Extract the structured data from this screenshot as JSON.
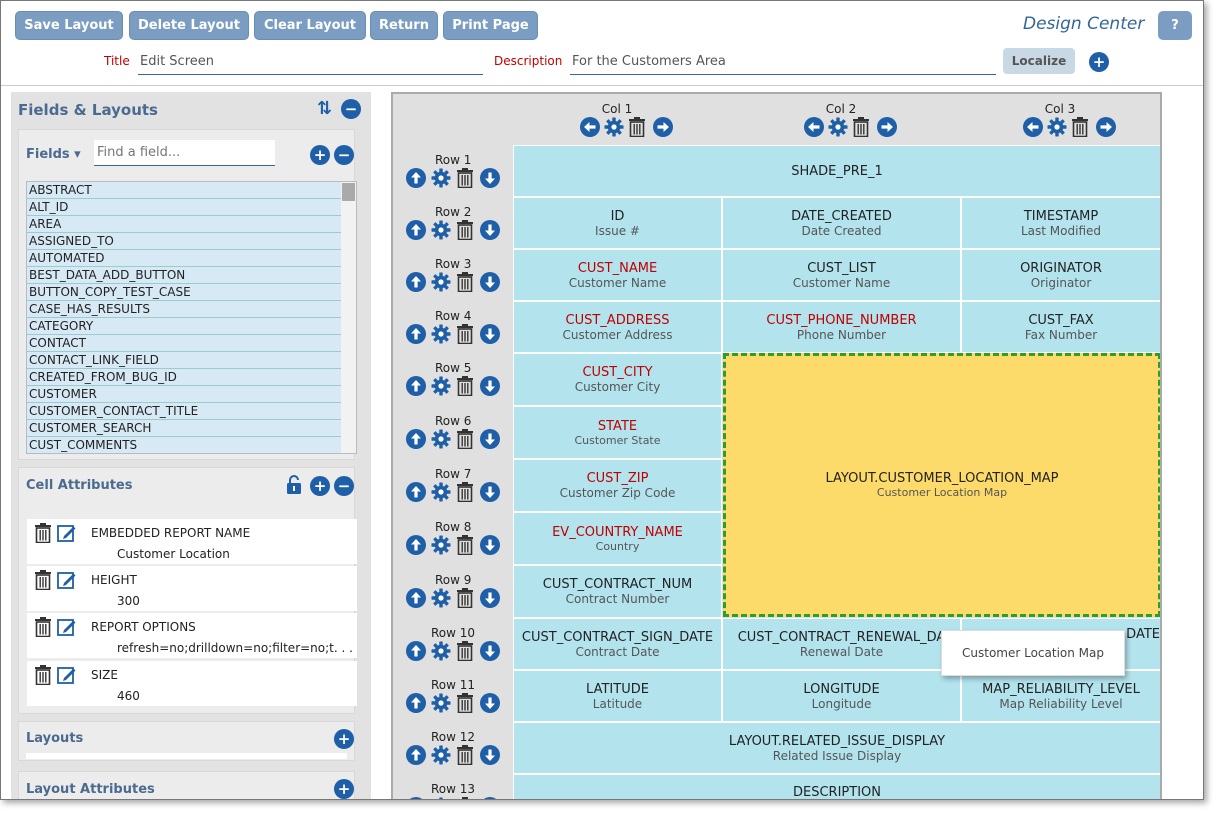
{
  "toolbar": {
    "buttons": [
      "Save Layout",
      "Delete Layout",
      "Clear Layout",
      "Return",
      "Print Page"
    ],
    "app_title": "Design Center",
    "help": "?"
  },
  "header": {
    "title_label": "Title",
    "title_value": "Edit Screen",
    "description_label": "Description",
    "description_value": "For the Customers Area",
    "localize": "Localize"
  },
  "left": {
    "title": "Fields & Layouts",
    "fields_label": "Fields ▾",
    "search_placeholder": "Find a field...",
    "fields": [
      "ABSTRACT",
      "ALT_ID",
      "AREA",
      "ASSIGNED_TO",
      "AUTOMATED",
      "BEST_DATA_ADD_BUTTON",
      "BUTTON_COPY_TEST_CASE",
      "CASE_HAS_RESULTS",
      "CATEGORY",
      "CONTACT",
      "CONTACT_LINK_FIELD",
      "CREATED_FROM_BUG_ID",
      "CUSTOMER",
      "CUSTOMER_CONTACT_TITLE",
      "CUSTOMER_SEARCH",
      "CUST_COMMENTS"
    ],
    "cell_attributes_title": "Cell Attributes",
    "attributes": [
      {
        "name": "EMBEDDED REPORT NAME",
        "value": "Customer Location"
      },
      {
        "name": "HEIGHT",
        "value": "300"
      },
      {
        "name": "REPORT OPTIONS",
        "value": "refresh=no;drilldown=no;filter=no;t. . ."
      },
      {
        "name": "SIZE",
        "value": "460"
      }
    ],
    "layouts_title": "Layouts",
    "layout_attributes_title": "Layout Attributes"
  },
  "grid": {
    "cols": [
      "Col 1",
      "Col 2",
      "Col 3"
    ],
    "rows": [
      "Row 1",
      "Row 2",
      "Row 3",
      "Row 4",
      "Row 5",
      "Row 6",
      "Row 7",
      "Row 8",
      "Row 9",
      "Row 10",
      "Row 11",
      "Row 12",
      "Row 13"
    ],
    "cells": {
      "r1": {
        "name": "SHADE_PRE_1"
      },
      "r2c1": {
        "name": "ID",
        "label": "Issue #"
      },
      "r2c2": {
        "name": "DATE_CREATED",
        "label": "Date Created"
      },
      "r2c3": {
        "name": "TIMESTAMP",
        "label": "Last Modified"
      },
      "r3c1": {
        "name": "CUST_NAME",
        "label": "Customer Name"
      },
      "r3c2": {
        "name": "CUST_LIST",
        "label": "Customer Name"
      },
      "r3c3": {
        "name": "ORIGINATOR",
        "label": "Originator"
      },
      "r4c1": {
        "name": "CUST_ADDRESS",
        "label": "Customer Address"
      },
      "r4c2": {
        "name": "CUST_PHONE_NUMBER",
        "label": "Phone Number"
      },
      "r4c3": {
        "name": "CUST_FAX",
        "label": "Fax Number"
      },
      "r5c1": {
        "name": "CUST_CITY",
        "label": "Customer City"
      },
      "r6c1": {
        "name": "STATE",
        "label": "Customer State"
      },
      "r7c1": {
        "name": "CUST_ZIP",
        "label": "Customer Zip Code"
      },
      "r8c1": {
        "name": "EV_COUNTRY_NAME",
        "label": "Country"
      },
      "r9c1": {
        "name": "CUST_CONTRACT_NUM",
        "label": "Contract Number"
      },
      "map": {
        "name": "LAYOUT.CUSTOMER_LOCATION_MAP",
        "label": "Customer Location Map"
      },
      "r10c1": {
        "name": "CUST_CONTRACT_SIGN_DATE",
        "label": "Contract Date"
      },
      "r10c2": {
        "name": "CUST_CONTRACT_RENEWAL_DA",
        "label": "Renewal Date"
      },
      "r10c3": {
        "name": "DATE"
      },
      "r11c1": {
        "name": "LATITUDE",
        "label": "Latitude"
      },
      "r11c2": {
        "name": "LONGITUDE",
        "label": "Longitude"
      },
      "r11c3": {
        "name": "MAP_RELIABILITY_LEVEL",
        "label": "Map Reliability Level"
      },
      "r12": {
        "name": "LAYOUT.RELATED_ISSUE_DISPLAY",
        "label": "Related Issue Display"
      },
      "r13": {
        "name": "DESCRIPTION"
      }
    },
    "tooltip": "Customer Location Map"
  },
  "colors": {
    "button": "#7b9dc2",
    "cell": "#b3e4ee",
    "map": "#fddb6a",
    "icon": "#1e5fa8",
    "required": "#c00000"
  }
}
